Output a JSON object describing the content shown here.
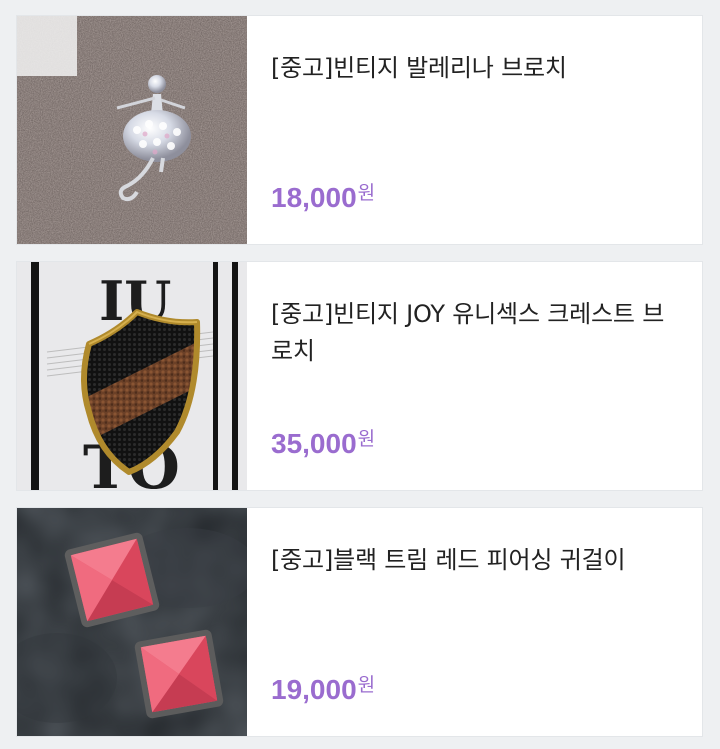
{
  "listings": [
    {
      "title": "[중고]빈티지 발레리나 브로치",
      "price": "18,000",
      "currency": "원",
      "image": "ballerina-brooch-photo"
    },
    {
      "title": "[중고]빈티지 JOY 유니섹스 크레스트 브로치",
      "price": "35,000",
      "currency": "원",
      "image": "crest-brooch-photo",
      "image_text": {
        "top": "IU",
        "bottom": "TO"
      }
    },
    {
      "title": "[중고]블랙 트림 레드 피어싱 귀걸이",
      "price": "19,000",
      "currency": "원",
      "image": "red-earrings-photo"
    }
  ],
  "colors": {
    "price": "#9a6ccf",
    "title": "#222222",
    "background": "#eef0f2",
    "card": "#ffffff"
  }
}
